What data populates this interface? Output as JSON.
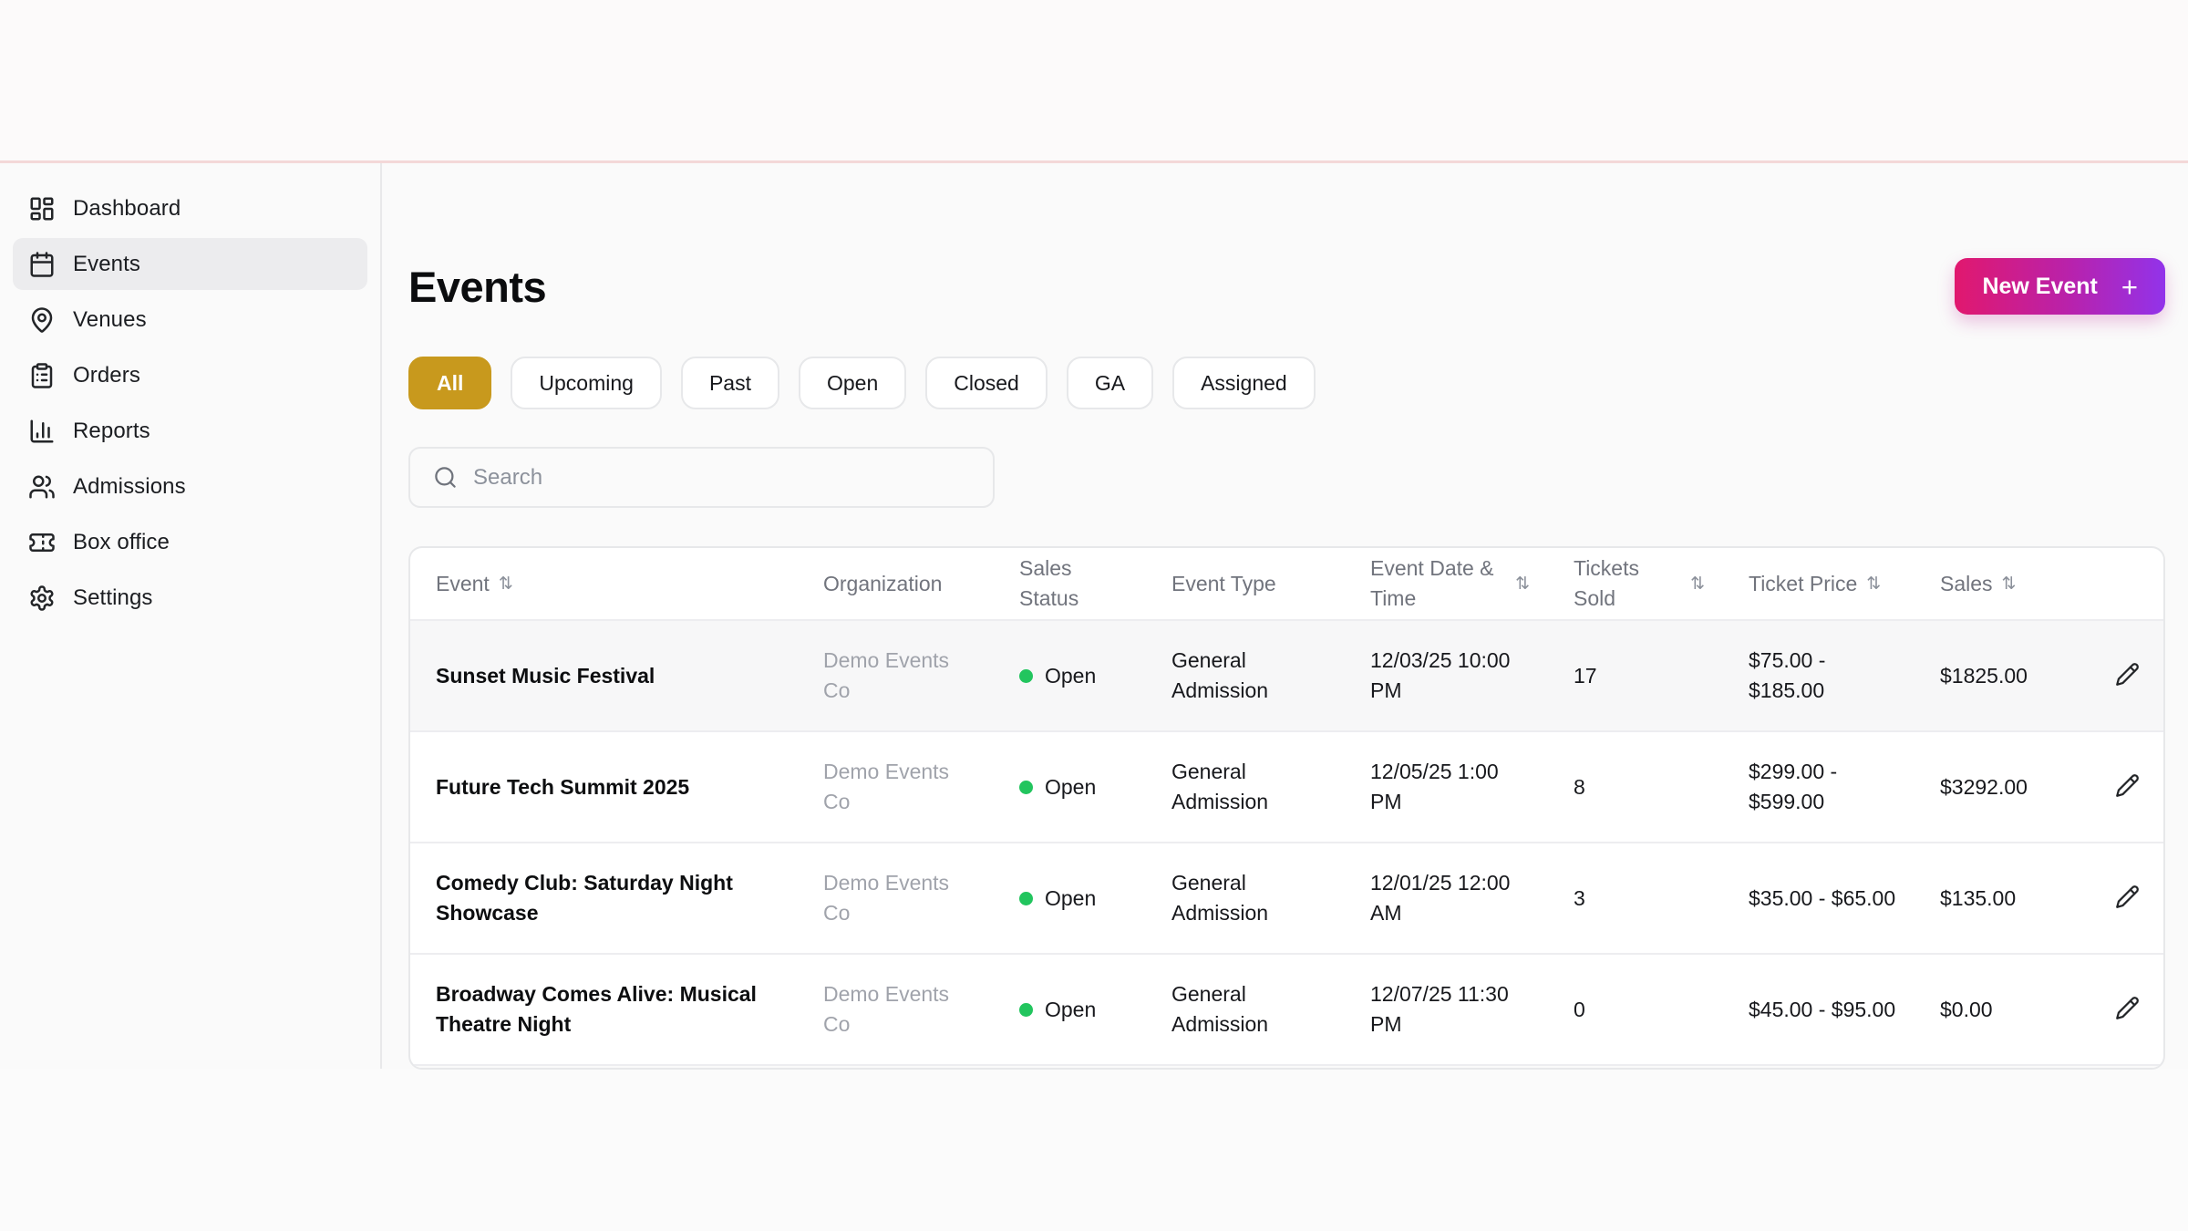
{
  "theme": {
    "accent_gradient_from": "#e1186e",
    "accent_gradient_to": "#9233ea",
    "active_filter_color": "#c8991d",
    "status_open_dot_color": "#22c55e",
    "top_divider_color": "#f3d8d8"
  },
  "sidebar": {
    "items": [
      {
        "label": "Dashboard",
        "icon": "dashboard-icon",
        "active": false
      },
      {
        "label": "Events",
        "icon": "calendar-icon",
        "active": true
      },
      {
        "label": "Venues",
        "icon": "map-pin-icon",
        "active": false
      },
      {
        "label": "Orders",
        "icon": "clipboard-icon",
        "active": false
      },
      {
        "label": "Reports",
        "icon": "bar-chart-icon",
        "active": false
      },
      {
        "label": "Admissions",
        "icon": "users-icon",
        "active": false
      },
      {
        "label": "Box office",
        "icon": "ticket-icon",
        "active": false
      },
      {
        "label": "Settings",
        "icon": "gear-icon",
        "active": false
      }
    ]
  },
  "header": {
    "title": "Events",
    "new_event_label": "New Event",
    "new_event_plus": "+"
  },
  "filters": {
    "options": [
      "All",
      "Upcoming",
      "Past",
      "Open",
      "Closed",
      "GA",
      "Assigned"
    ],
    "active": "All"
  },
  "search": {
    "placeholder": "Search",
    "value": ""
  },
  "table": {
    "sort_glyph": "⇅",
    "columns": [
      {
        "label": "Event",
        "sortable": true
      },
      {
        "label": "Organization",
        "sortable": false
      },
      {
        "label": "Sales Status",
        "sortable": false
      },
      {
        "label": "Event Type",
        "sortable": false
      },
      {
        "label": "Event Date & Time",
        "sortable": true
      },
      {
        "label": "Tickets Sold",
        "sortable": true
      },
      {
        "label": "Ticket Price",
        "sortable": true
      },
      {
        "label": "Sales",
        "sortable": true
      }
    ],
    "rows": [
      {
        "event": "Sunset Music Festival",
        "organization": "Demo Events Co",
        "sales_status": "Open",
        "event_type": "General Admission",
        "date_time": "12/03/25 10:00 PM",
        "tickets_sold": "17",
        "ticket_price": "$75.00 - $185.00",
        "sales": "$1825.00",
        "highlighted": true
      },
      {
        "event": "Future Tech Summit 2025",
        "organization": "Demo Events Co",
        "sales_status": "Open",
        "event_type": "General Admission",
        "date_time": "12/05/25 1:00 PM",
        "tickets_sold": "8",
        "ticket_price": "$299.00 - $599.00",
        "sales": "$3292.00",
        "highlighted": false
      },
      {
        "event": "Comedy Club: Saturday Night Showcase",
        "organization": "Demo Events Co",
        "sales_status": "Open",
        "event_type": "General Admission",
        "date_time": "12/01/25 12:00 AM",
        "tickets_sold": "3",
        "ticket_price": "$35.00 - $65.00",
        "sales": "$135.00",
        "highlighted": false
      },
      {
        "event": "Broadway Comes Alive: Musical Theatre Night",
        "organization": "Demo Events Co",
        "sales_status": "Open",
        "event_type": "General Admission",
        "date_time": "12/07/25 11:30 PM",
        "tickets_sold": "0",
        "ticket_price": "$45.00 - $95.00",
        "sales": "$0.00",
        "highlighted": false
      }
    ]
  }
}
